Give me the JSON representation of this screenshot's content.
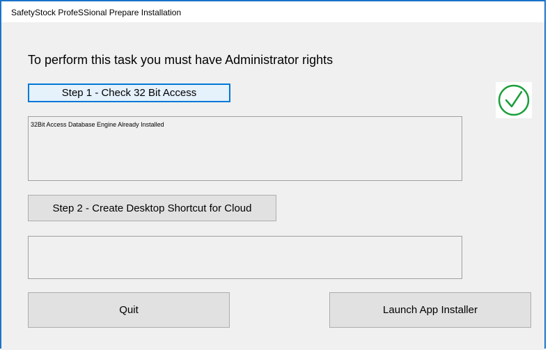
{
  "window": {
    "title": "SafetyStock ProfeSSional Prepare Installation"
  },
  "main": {
    "heading": "To perform this task you must have Administrator rights",
    "step1": {
      "button_label": "Step 1 - Check 32 Bit Access",
      "output_text": "32Bit Access Database Engine Already Installed",
      "status_icon": "check-circle-icon",
      "status_color": "#1a9e3a"
    },
    "step2": {
      "button_label": "Step 2 - Create Desktop Shortcut for Cloud",
      "output_text": ""
    },
    "footer": {
      "quit_label": "Quit",
      "launch_label": "Launch App Installer"
    }
  },
  "colors": {
    "window_border": "#1a73c9",
    "client_background": "#f0f0f0",
    "focus_border": "#0078d7"
  }
}
